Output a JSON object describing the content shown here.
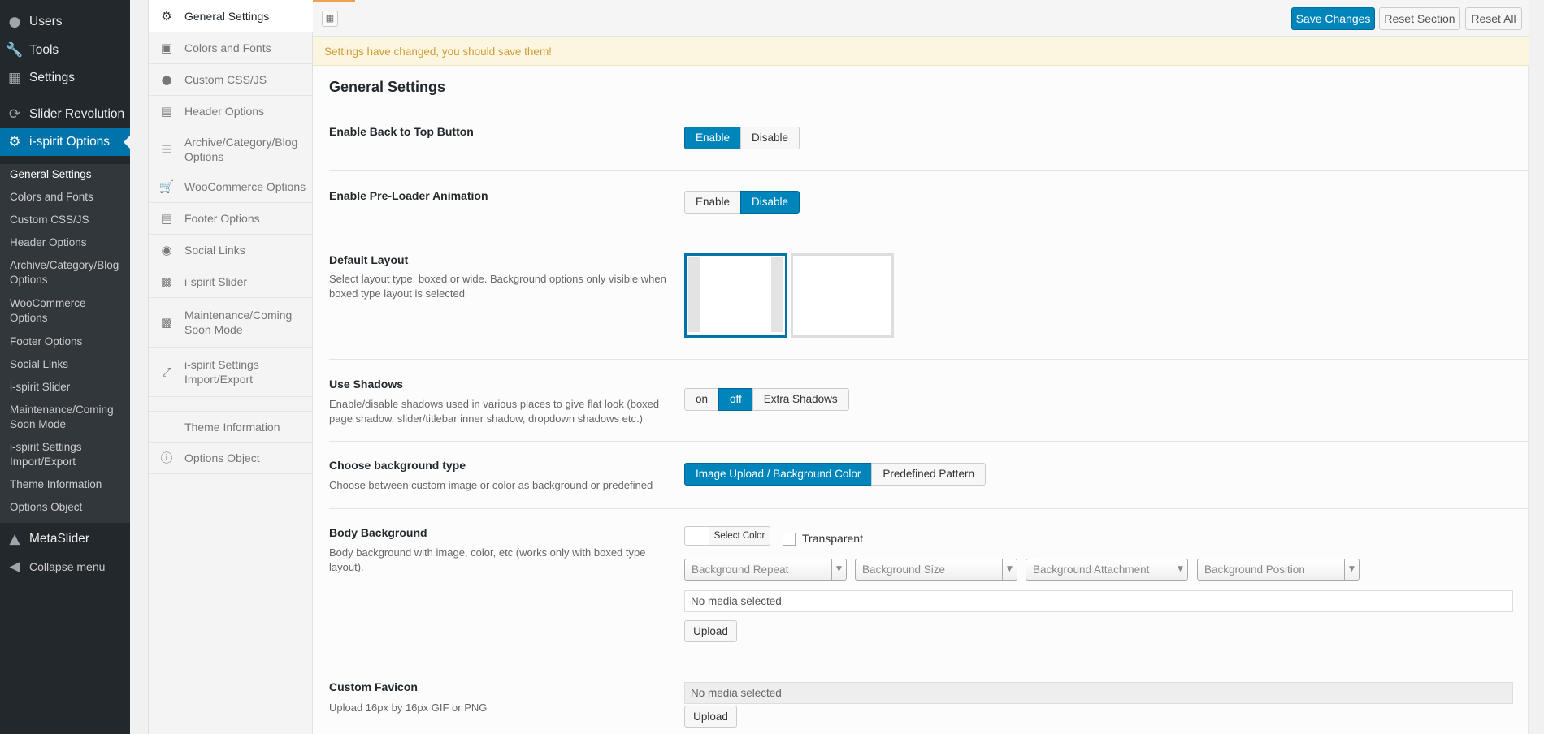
{
  "wp_menu": {
    "items": [
      {
        "label": "Users",
        "icon": "user-icon"
      },
      {
        "label": "Tools",
        "icon": "wrench-icon"
      },
      {
        "label": "Settings",
        "icon": "settings-icon"
      },
      {
        "label": "Slider Revolution",
        "icon": "refresh-icon"
      },
      {
        "label": "i-spirit Options",
        "icon": "gear-icon"
      }
    ],
    "submenu": [
      "General Settings",
      "Colors and Fonts",
      "Custom CSS/JS",
      "Header Options",
      "Archive/Category/Blog Options",
      "WooCommerce Options",
      "Footer Options",
      "Social Links",
      "i-spirit Slider",
      "Maintenance/Coming Soon Mode",
      "i-spirit Settings Import/Export",
      "Theme Information",
      "Options Object"
    ],
    "bottom": [
      {
        "label": "MetaSlider",
        "icon": "metaslider-icon"
      },
      {
        "label": "Collapse menu",
        "icon": "collapse-icon"
      }
    ]
  },
  "panel_menu": [
    {
      "label": "General Settings",
      "icon": "cogs-icon"
    },
    {
      "label": "Colors and Fonts",
      "icon": "palette-icon"
    },
    {
      "label": "Custom CSS/JS",
      "icon": "code-icon"
    },
    {
      "label": "Header Options",
      "icon": "header-icon"
    },
    {
      "label": "Archive/Category/Blog Options",
      "icon": "list-icon"
    },
    {
      "label": "WooCommerce Options",
      "icon": "cart-icon"
    },
    {
      "label": "Footer Options",
      "icon": "footer-icon"
    },
    {
      "label": "Social Links",
      "icon": "globe-icon"
    },
    {
      "label": "i-spirit Slider",
      "icon": "image-icon"
    },
    {
      "label": "Maintenance/Coming Soon Mode",
      "icon": "image-icon"
    },
    {
      "label": "i-spirit Settings Import/Export",
      "icon": "compress-icon"
    },
    {
      "label": "Theme Information",
      "icon": ""
    },
    {
      "label": "Options Object",
      "icon": "info-icon"
    }
  ],
  "toolbar": {
    "save": "Save Changes",
    "reset_section": "Reset Section",
    "reset_all": "Reset All"
  },
  "notice": "Settings have changed, you should save them!",
  "section_title": "General Settings",
  "settings": {
    "back_to_top": {
      "title": "Enable Back to Top Button",
      "options": [
        "Enable",
        "Disable"
      ],
      "selected": "Enable"
    },
    "preloader": {
      "title": "Enable Pre-Loader Animation",
      "options": [
        "Enable",
        "Disable"
      ],
      "selected": "Disable"
    },
    "layout": {
      "title": "Default Layout",
      "desc": "Select layout type. boxed or wide. Background options only visible when boxed type layout is selected",
      "selected": "boxed"
    },
    "shadows": {
      "title": "Use Shadows",
      "desc": "Enable/disable shadows used in various places to give flat look (boxed page shadow, slider/titlebar inner shadow, dropdown shadows etc.)",
      "options": [
        "on",
        "off",
        "Extra Shadows"
      ],
      "selected": "off"
    },
    "bg_type": {
      "title": "Choose background type",
      "desc": "Choose between custom image or color as background or predefined",
      "options": [
        "Image Upload / Background Color",
        "Predefined Pattern"
      ],
      "selected": "Image Upload / Background Color"
    },
    "body_bg": {
      "title": "Body Background",
      "desc": "Body background with image, color, etc (works only with boxed type layout).",
      "select_color": "Select Color",
      "transparent": "Transparent",
      "selects": [
        "Background Repeat",
        "Background Size",
        "Background Attachment",
        "Background Position"
      ],
      "media": "No media selected",
      "upload": "Upload"
    },
    "favicon": {
      "title": "Custom Favicon",
      "desc": "Upload 16px by 16px GIF or PNG",
      "media": "No media selected",
      "upload": "Upload"
    }
  }
}
